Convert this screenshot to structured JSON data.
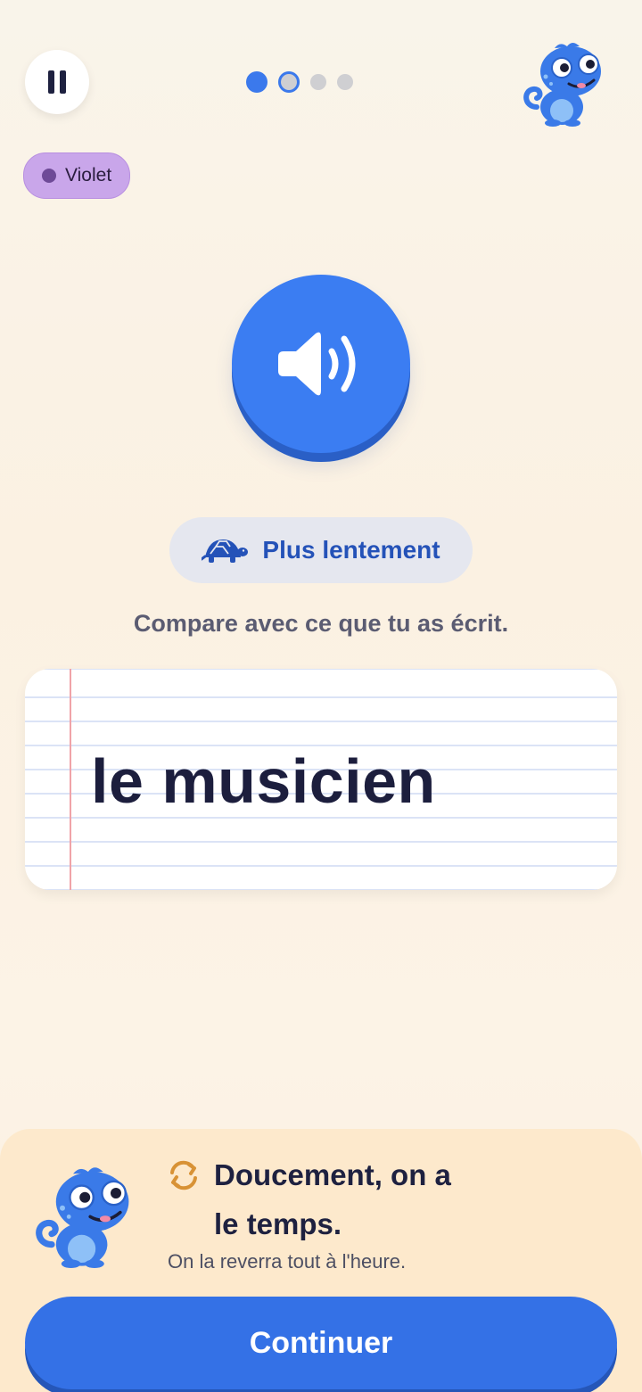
{
  "header": {
    "pause_icon": "pause-icon",
    "progress": {
      "total": 4,
      "completed": 1,
      "current": 2
    },
    "mascot_icon": "chameleon-mascot-icon"
  },
  "tag": {
    "label": "Violet",
    "color": "#c9a6ea"
  },
  "audio": {
    "icon": "speaker-icon",
    "color": "#3b7df2"
  },
  "slow_button": {
    "label": "Plus lentement",
    "icon": "turtle-icon"
  },
  "instruction": "Compare avec ce que tu as écrit.",
  "answer": {
    "word": "le musicien"
  },
  "feedback": {
    "icon": "refresh-icon",
    "title_line1": "Doucement, on a",
    "title_line2": "le temps.",
    "subtitle": "On la reverra tout à l'heure.",
    "background": "#fde9cc"
  },
  "continue_button": {
    "label": "Continuer",
    "color": "#3471e6"
  }
}
